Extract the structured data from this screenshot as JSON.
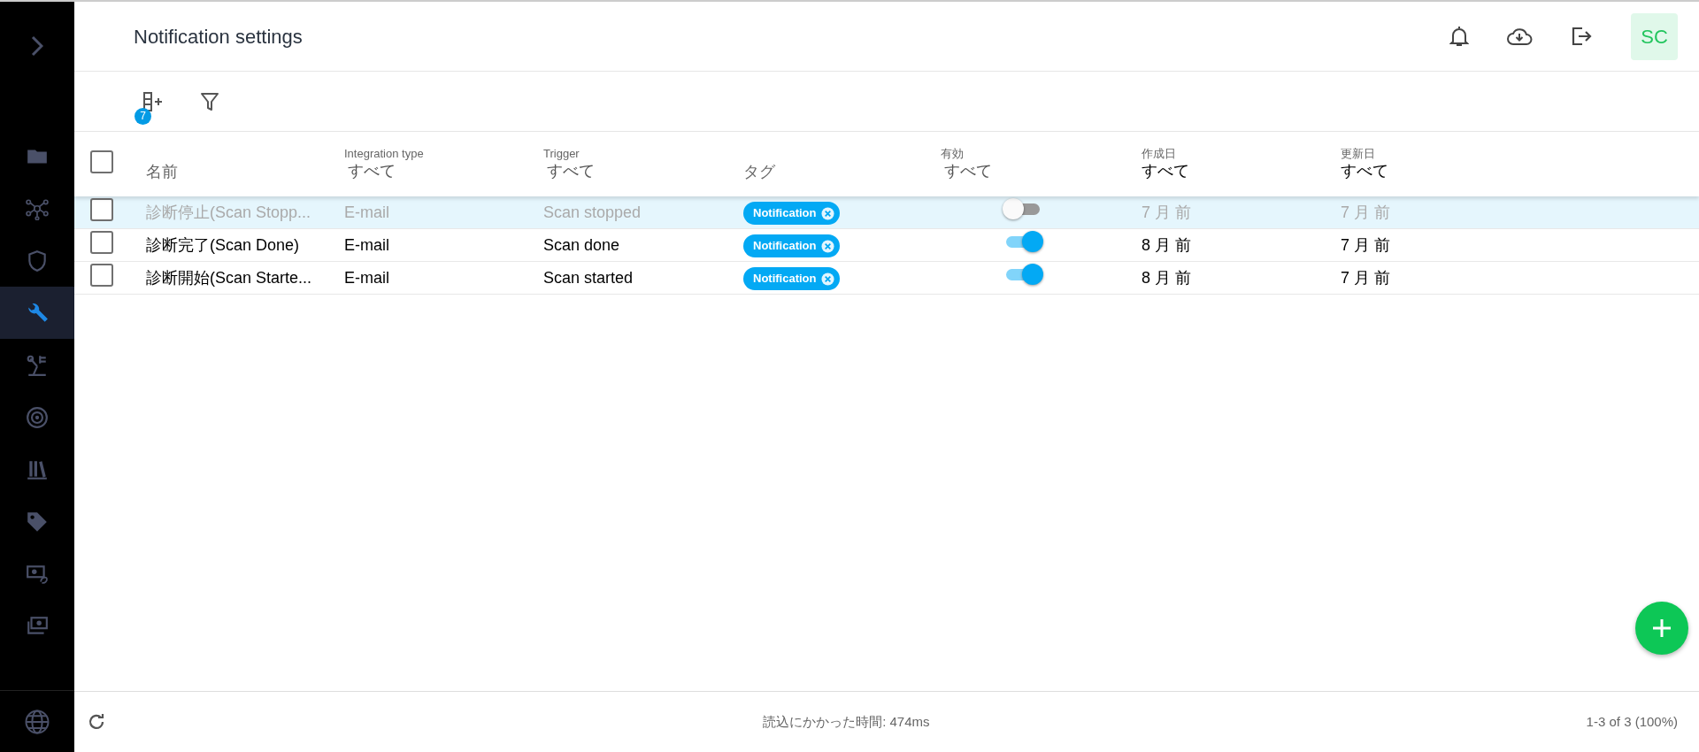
{
  "page": {
    "title": "Notification settings"
  },
  "header": {
    "avatar": "SC"
  },
  "sidebar": {
    "items": [
      {
        "selected": false
      },
      {
        "selected": false
      },
      {
        "selected": false
      },
      {
        "selected": true
      },
      {
        "selected": false
      },
      {
        "selected": false
      },
      {
        "selected": false
      },
      {
        "selected": false
      },
      {
        "selected": false
      },
      {
        "selected": false
      }
    ]
  },
  "toolbar": {
    "column_badge": "7"
  },
  "table": {
    "select_all_checked": false,
    "columns": [
      {
        "label": "名前",
        "kind": "plain"
      },
      {
        "label": "Integration type",
        "filter": "すべて",
        "kind": "select"
      },
      {
        "label": "Trigger",
        "filter": "すべて",
        "kind": "select"
      },
      {
        "label": "タグ",
        "kind": "plain"
      },
      {
        "label": "有効",
        "filter": "すべて",
        "kind": "select"
      },
      {
        "label": "作成日",
        "filter": "すべて",
        "kind": "date"
      },
      {
        "label": "更新日",
        "filter": "すべて",
        "kind": "date"
      }
    ],
    "rows": [
      {
        "checked": false,
        "highlighted": true,
        "name": "診断停止(Scan Stopp...",
        "integration": "E-mail",
        "trigger": "Scan stopped",
        "tag": "Notification",
        "enabled": false,
        "created": "7 月 前",
        "updated": "7 月 前"
      },
      {
        "checked": false,
        "highlighted": false,
        "name": "診断完了(Scan Done)",
        "integration": "E-mail",
        "trigger": "Scan done",
        "tag": "Notification",
        "enabled": true,
        "created": "8 月 前",
        "updated": "7 月 前"
      },
      {
        "checked": false,
        "highlighted": false,
        "name": "診断開始(Scan Starte...",
        "integration": "E-mail",
        "trigger": "Scan started",
        "tag": "Notification",
        "enabled": true,
        "created": "8 月 前",
        "updated": "7 月 前"
      }
    ]
  },
  "status_bar": {
    "load_time": "読込にかかった時間: 474ms",
    "range": "1-3 of 3 (100%)"
  }
}
